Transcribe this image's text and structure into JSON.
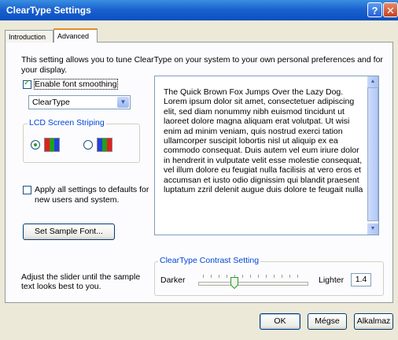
{
  "window": {
    "title": "ClearType Settings",
    "help_label": "?",
    "close_label": "✕"
  },
  "tabs": [
    {
      "label": "Introduction",
      "active": false
    },
    {
      "label": "Advanced",
      "active": true
    }
  ],
  "description": "This setting allows you to tune ClearType on your system to your own personal preferences and for your display.",
  "font_smoothing": {
    "label": "Enable font smoothing",
    "checked": true,
    "method": "ClearType"
  },
  "lcd_striping": {
    "title": "LCD Screen Striping",
    "options": [
      {
        "order": "RGB",
        "selected": true,
        "colors": [
          "#e02020",
          "#20a020",
          "#2040e0"
        ]
      },
      {
        "order": "BGR",
        "selected": false,
        "colors": [
          "#2040e0",
          "#20a020",
          "#e02020"
        ]
      }
    ]
  },
  "apply_defaults": {
    "label_line1": "Apply all settings to defaults for",
    "label_line2": "new users and system.",
    "checked": false
  },
  "set_sample_font_label": "Set Sample Font...",
  "sample_text": "The Quick Brown Fox Jumps Over the Lazy Dog. Lorem ipsum dolor sit amet, consectetuer adipiscing elit, sed diam nonummy nibh euismod tincidunt ut laoreet dolore magna aliquam erat volutpat. Ut wisi enim ad minim veniam, quis nostrud exerci tation ullamcorper suscipit lobortis nisl ut aliquip ex ea commodo consequat. Duis autem vel eum iriure dolor in hendrerit in vulputate velit esse molestie consequat, vel illum dolore eu feugiat nulla facilisis at vero eros et accumsan et iusto odio dignissim qui blandit praesent luptatum zzril delenit augue duis dolore te feugait nulla",
  "hint": "Adjust the slider until the sample text looks best to you.",
  "contrast": {
    "title": "ClearType Contrast Setting",
    "left_label": "Darker",
    "right_label": "Lighter",
    "value": "1.4"
  },
  "buttons": {
    "ok": "OK",
    "cancel": "Mégse",
    "apply": "Alkalmaz"
  }
}
